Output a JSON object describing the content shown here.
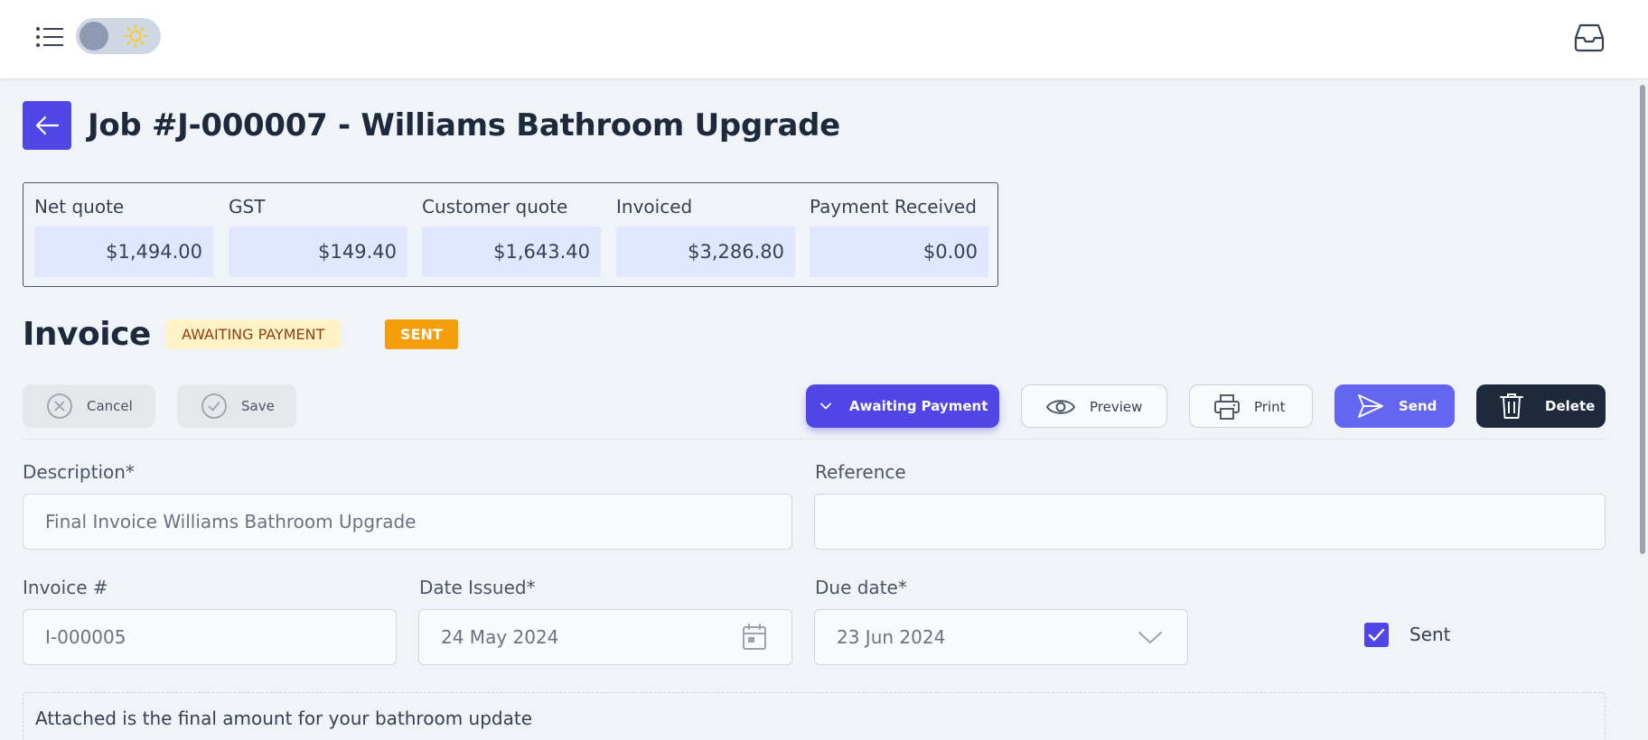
{
  "job": {
    "title": "Job #J-000007 - Williams Bathroom Upgrade"
  },
  "summary": [
    {
      "label": "Net quote",
      "value": "$1,494.00"
    },
    {
      "label": "GST",
      "value": "$149.40"
    },
    {
      "label": "Customer quote",
      "value": "$1,643.40"
    },
    {
      "label": "Invoiced",
      "value": "$3,286.80"
    },
    {
      "label": "Payment Received",
      "value": "$0.00"
    }
  ],
  "invoice": {
    "heading": "Invoice",
    "status_badge": "AWAITING PAYMENT",
    "sent_badge": "SENT"
  },
  "toolbar": {
    "cancel_label": "Cancel",
    "save_label": "Save",
    "status_label": "Awaiting Payment",
    "preview_label": "Preview",
    "print_label": "Print",
    "send_label": "Send",
    "delete_label": "Delete"
  },
  "form": {
    "description_label": "Description*",
    "description_value": "Final Invoice Williams Bathroom Upgrade",
    "reference_label": "Reference",
    "reference_value": "",
    "invoice_no_label": "Invoice #",
    "invoice_no_value": "I-000005",
    "date_issued_label": "Date Issued*",
    "date_issued_value": "24 May 2024",
    "due_date_label": "Due date*",
    "due_date_value": "23 Jun 2024",
    "sent_label": "Sent",
    "sent_checked": true,
    "note_text": "Attached is the final amount for your bathroom update"
  },
  "colors": {
    "primary": "#4f46e5",
    "send": "#6366f1",
    "delete": "#1e293b",
    "awaiting_bg": "#fef3c7",
    "sent_bg": "#f59e0b",
    "summary_value_bg": "#e0e7ff"
  },
  "icons": {
    "menu": "list-icon",
    "theme": "sun-icon",
    "inbox": "inbox-icon",
    "back": "arrow-left-icon",
    "cancel": "x-circle-icon",
    "save": "check-circle-icon",
    "status": "chevron-down-icon",
    "preview": "eye-icon",
    "print": "printer-icon",
    "send": "paper-plane-icon",
    "delete": "trash-icon",
    "calendar": "calendar-icon",
    "dropdown": "chevron-down-icon"
  }
}
